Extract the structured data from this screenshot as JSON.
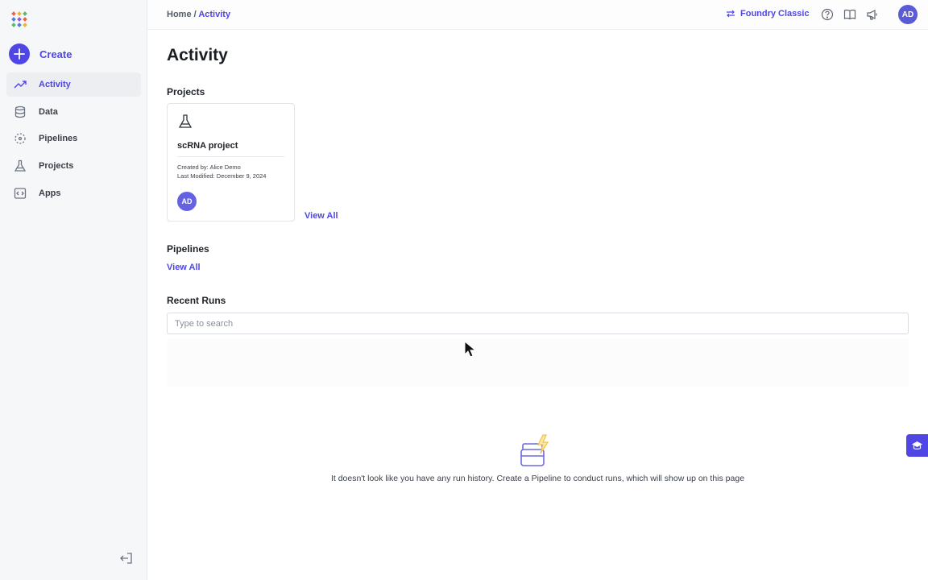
{
  "breadcrumb": {
    "home": "Home",
    "separator": " / ",
    "current": "Activity"
  },
  "topbar": {
    "classic_label": "Foundry Classic",
    "icons": [
      "help-icon",
      "book-icon",
      "megaphone-icon"
    ],
    "avatar_initials": "AD"
  },
  "sidebar": {
    "create_label": "Create",
    "items": [
      {
        "label": "Activity",
        "icon": "trend-up-icon",
        "active": true
      },
      {
        "label": "Data",
        "icon": "database-icon"
      },
      {
        "label": "Pipelines",
        "icon": "pipeline-icon"
      },
      {
        "label": "Projects",
        "icon": "flask-icon"
      },
      {
        "label": "Apps",
        "icon": "code-icon"
      }
    ]
  },
  "page": {
    "title": "Activity"
  },
  "projects": {
    "heading": "Projects",
    "view_all": "View All",
    "cards": [
      {
        "title": "scRNA project",
        "created_by": "Created by: Alice Demo",
        "last_modified": "Last Modified: December 9, 2024",
        "avatar_initials": "AD"
      }
    ]
  },
  "pipelines": {
    "heading": "Pipelines",
    "view_all": "View All"
  },
  "recent_runs": {
    "heading": "Recent Runs",
    "search_placeholder": "Type to search",
    "empty_message": "It doesn't look like you have any run history. Create a Pipeline to conduct runs, which will show up on this page"
  },
  "colors": {
    "accent": "#4f46e5",
    "sidebar_bg": "#f6f7f9",
    "avatar": "#5b5bd6"
  }
}
